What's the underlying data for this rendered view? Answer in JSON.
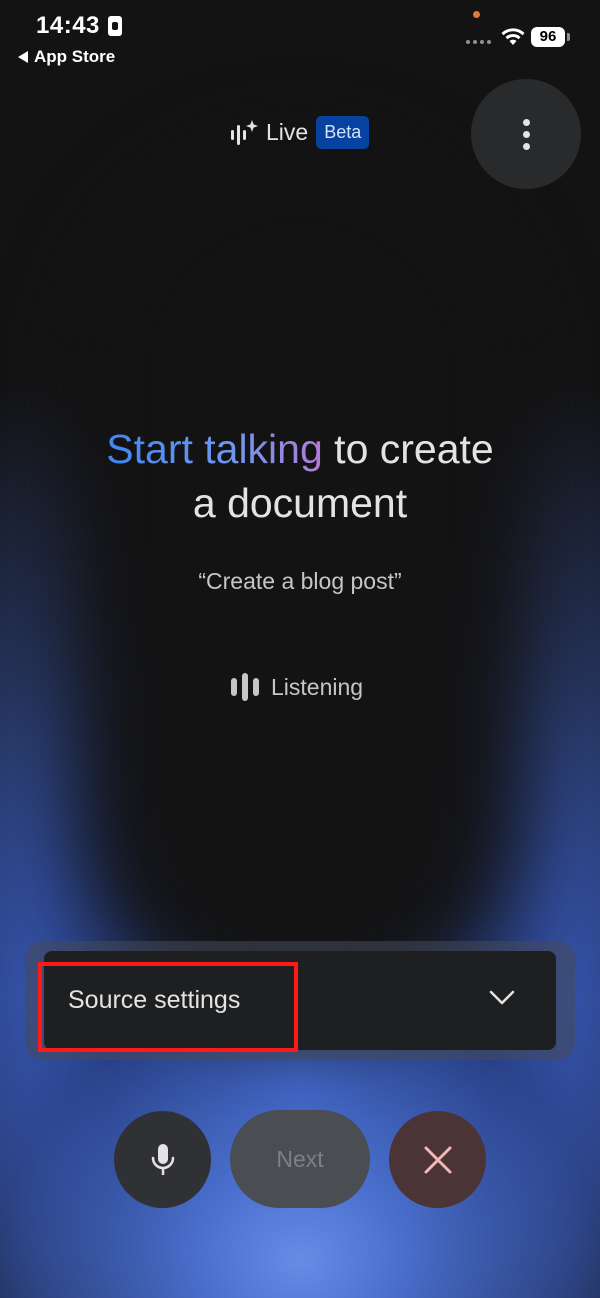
{
  "status_bar": {
    "time": "14:43",
    "back_label": "App Store",
    "battery": "96"
  },
  "header": {
    "title": "Live",
    "badge": "Beta"
  },
  "main": {
    "heading_highlight": "Start talking",
    "heading_rest_line1": " to create",
    "heading_line2": "a document",
    "hint": "“Create a blog post”",
    "status": "Listening"
  },
  "source_settings": {
    "label": "Source settings"
  },
  "controls": {
    "next_label": "Next"
  },
  "colors": {
    "background": "#131314",
    "accent_blue": "#4285f4",
    "beta_badge": "#0842a0",
    "highlight_box": "#ff1a1a"
  },
  "icons": [
    "sparkle-waveform-icon",
    "more-vert-icon",
    "listening-bars-icon",
    "chevron-down-icon",
    "mic-icon",
    "close-icon",
    "wifi-icon"
  ]
}
